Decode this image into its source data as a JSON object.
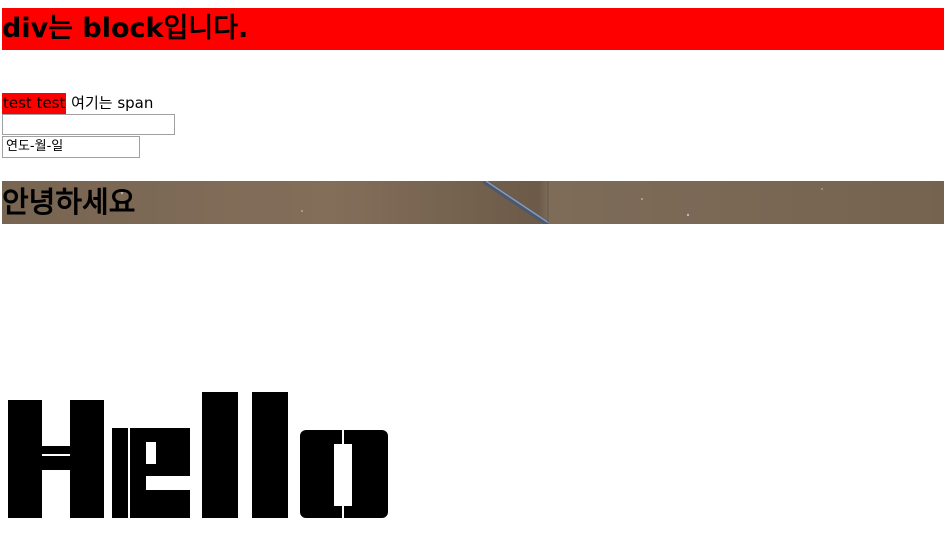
{
  "block_heading": "div는 block입니다.",
  "spans": {
    "red_text": "test test",
    "plain_text": "여기는 span"
  },
  "text_input": {
    "value": ""
  },
  "date_input": {
    "placeholder": "연도-월-일"
  },
  "banner": {
    "title": "안녕하세요"
  },
  "hello_text": "Hello",
  "colors": {
    "red": "#ff0000",
    "banner_brown": "#7d6a55"
  }
}
